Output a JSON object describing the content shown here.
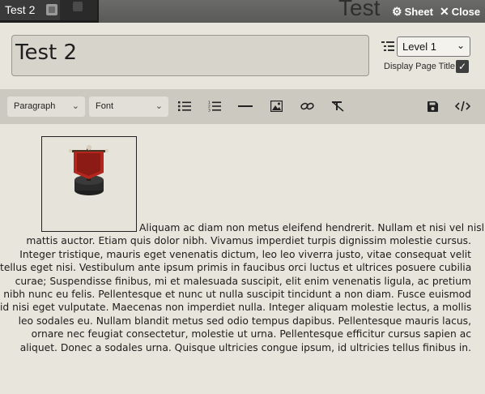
{
  "window": {
    "tab_label": "Test 2",
    "title": "Test",
    "sheet_label": "Sheet",
    "close_label": "Close"
  },
  "header": {
    "page_title": "Test 2",
    "level_select": "Level 1",
    "display_page_title_label": "Display Page Title",
    "display_page_title_checked": true
  },
  "toolbar": {
    "paragraph_select": "Paragraph",
    "font_select": "Font",
    "tools": [
      "bullet-list-icon",
      "numbered-list-icon",
      "horizontal-rule-icon",
      "image-icon",
      "link-icon",
      "clear-format-icon",
      "save-icon",
      "code-view-icon"
    ]
  },
  "editor": {
    "image_alt": "red banner token",
    "lines": [
      "Aliquam ac diam non metus eleifend hendrerit. Nullam et nisi vel nisl",
      "mattis auctor. Etiam quis dolor nibh. Vivamus imperdiet turpis dignissim molestie cursus.",
      "Integer tristique, mauris eget venenatis dictum, leo leo viverra justo, vitae consequat velit",
      "tellus eget nisi. Vestibulum ante ipsum primis in faucibus orci luctus et ultrices posuere cubilia",
      "curae; Suspendisse finibus, mi et malesuada suscipit, elit enim venenatis ligula, ac pretium",
      "nibh nunc eu felis. Pellentesque et nunc ut nulla suscipit tincidunt a non diam. Fusce euismod",
      "id nisi eget vulputate. Maecenas non imperdiet nulla. Integer aliquam molestie lectus, a mollis",
      "leo sodales eu. Nullam blandit metus sed odio tempus dapibus. Pellentesque mauris lacus,",
      "ornare nec feugiat consectetur, molestie ut urna. Pellentesque efficitur cursus sapien ac",
      "aliquet. Donec a sodales urna. Quisque ultricies congue ipsum, id ultricies tellus finibus in."
    ]
  },
  "colors": {
    "background": "#e8e5dd",
    "titlebar": "#1d1d1d",
    "toolbar": "#ccc9c1",
    "banner_red": "#b3261e"
  }
}
